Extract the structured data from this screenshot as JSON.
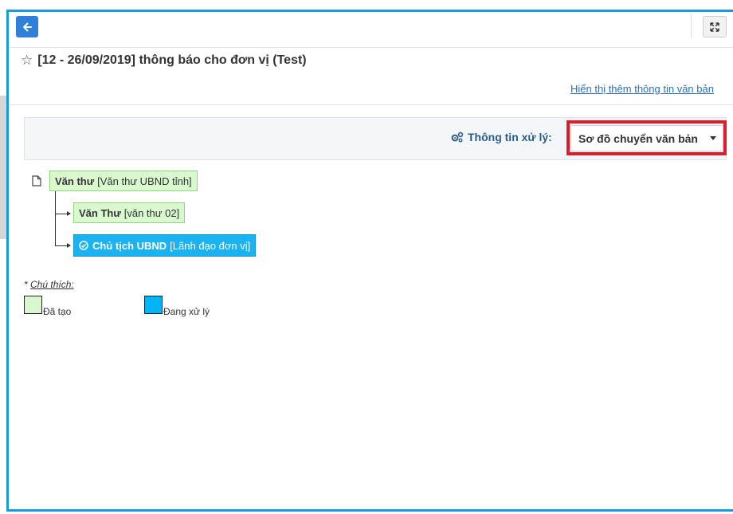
{
  "toolbar": {
    "back_icon": "arrow-left-icon",
    "expand_icon": "expand-icon"
  },
  "document": {
    "title": "[12 - 26/09/2019] thông báo cho đơn vị (Test)",
    "more_info_link": "Hiển thị thêm thông tin văn bản"
  },
  "processing_info": {
    "label": "Thông tin xử lý:",
    "icon": "gears-icon",
    "view_selected": "Sơ đồ chuyển văn bản"
  },
  "flow": {
    "root": {
      "role": "Văn thư",
      "detail": "[Văn thư UBND tỉnh]",
      "status": "created"
    },
    "children": [
      {
        "role": "Văn Thư",
        "detail": "[văn thư 02]",
        "status": "created"
      },
      {
        "role": "Chủ tịch UBND",
        "detail": "[Lãnh đạo đơn vị]",
        "status": "processing"
      }
    ]
  },
  "legend": {
    "prefix": "* ",
    "title": "Chú thích:",
    "items": [
      {
        "label": "Đã tạo",
        "color": "#d9f8d0"
      },
      {
        "label": "Đang xử lý",
        "color": "#00b4f5"
      }
    ]
  },
  "colors": {
    "accent": "#1a9be0",
    "highlight": "#e01b2a",
    "link": "#2a6fb8"
  }
}
